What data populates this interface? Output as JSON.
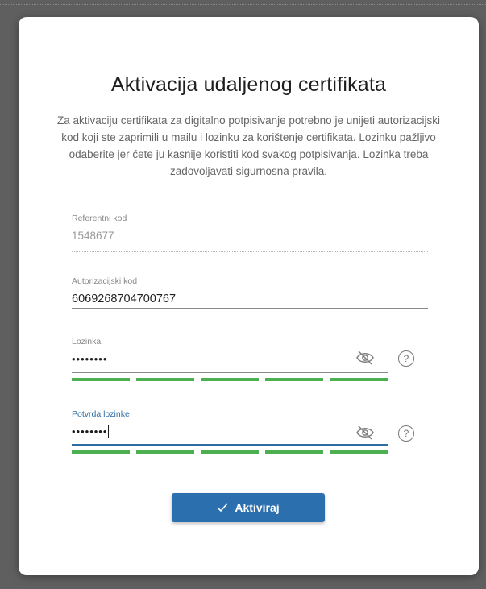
{
  "dialog": {
    "title": "Aktivacija udaljenog certifikata",
    "description": "Za aktivaciju certifikata za digitalno potpisivanje potrebno je unijeti autorizacijski kod koji ste zaprimili u mailu i lozinku za korištenje certifikata. Lozinku pažljivo odaberite jer ćete ju kasnije koristiti kod svakog potpisivanja. Lozinka treba zadovoljavati sigurnosna pravila."
  },
  "fields": {
    "reference": {
      "label": "Referentni kod",
      "value": "1548677"
    },
    "authorization": {
      "label": "Autorizacijski kod",
      "value": "6069268704700767"
    },
    "password": {
      "label": "Lozinka",
      "value": "••••••••",
      "strength_segments_filled": 5,
      "strength_segments_total": 5
    },
    "confirm": {
      "label": "Potvrda lozinke",
      "value": "••••••••",
      "strength_segments_filled": 5,
      "strength_segments_total": 5
    }
  },
  "icons": {
    "visibility": "eye-off-icon",
    "help": "help-icon",
    "help_glyph": "?",
    "check": "check-icon"
  },
  "colors": {
    "accent": "#2b6fae",
    "strength": "#4caf50",
    "focus": "#2e6da4"
  },
  "actions": {
    "activate_label": "Aktiviraj"
  }
}
